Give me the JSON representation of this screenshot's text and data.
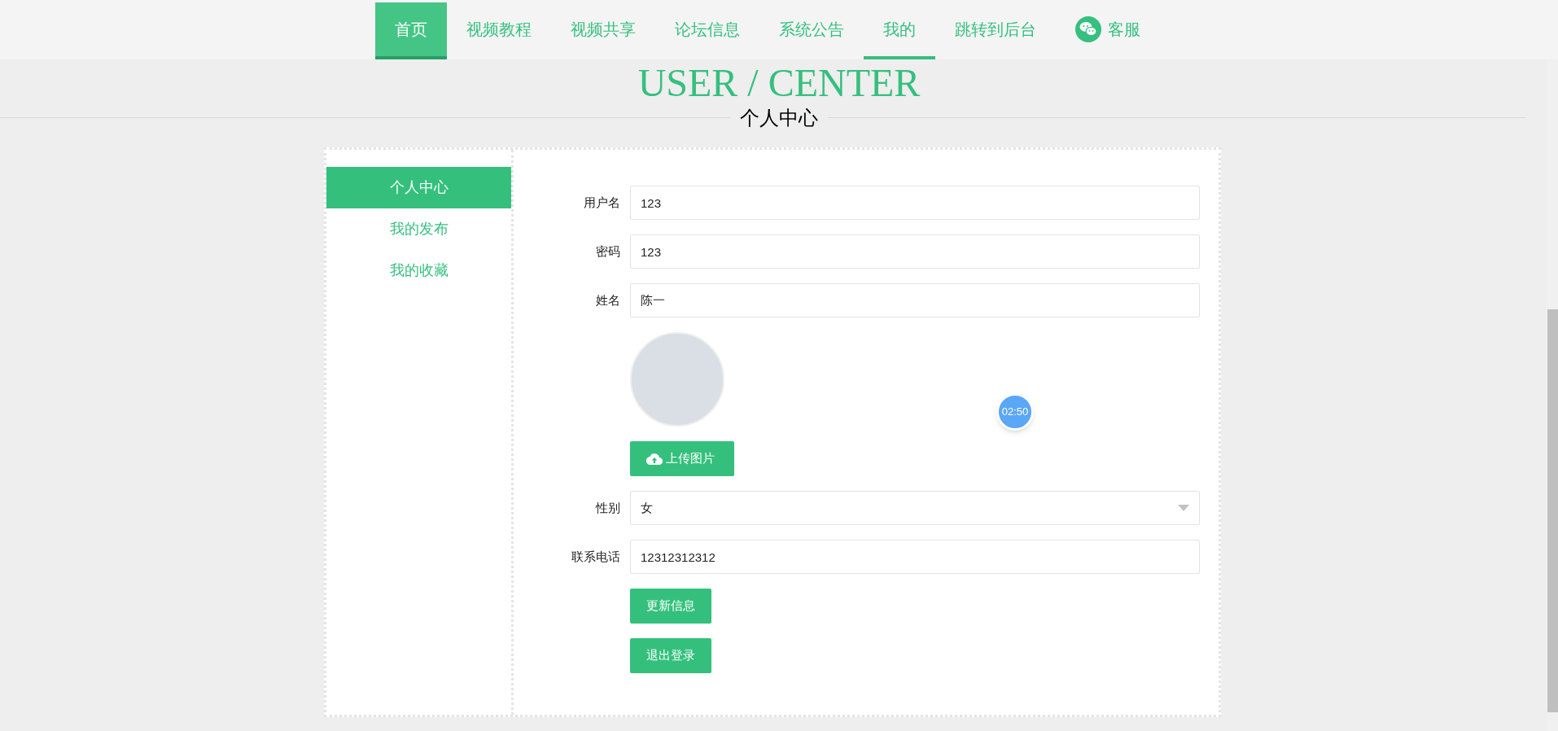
{
  "nav": {
    "items": [
      {
        "label": "首页",
        "kind": "text",
        "selected": false,
        "hovered": true
      },
      {
        "label": "视频教程",
        "kind": "text",
        "selected": false,
        "hovered": false
      },
      {
        "label": "视频共享",
        "kind": "text",
        "selected": false,
        "hovered": false
      },
      {
        "label": "论坛信息",
        "kind": "text",
        "selected": false,
        "hovered": false
      },
      {
        "label": "系统公告",
        "kind": "text",
        "selected": false,
        "hovered": false
      },
      {
        "label": "我的",
        "kind": "text",
        "selected": true,
        "hovered": false
      },
      {
        "label": "跳转到后台",
        "kind": "text",
        "selected": false,
        "hovered": false
      },
      {
        "label": "客服",
        "kind": "wechat",
        "selected": false,
        "hovered": false
      }
    ]
  },
  "header": {
    "title": "USER / CENTER",
    "subtitle": "个人中心"
  },
  "sidebar": {
    "items": [
      {
        "label": "个人中心",
        "selected": true
      },
      {
        "label": "我的发布",
        "selected": false
      },
      {
        "label": "我的收藏",
        "selected": false
      }
    ]
  },
  "form": {
    "rows": [
      {
        "kind": "text",
        "label": "用户名",
        "value": "123"
      },
      {
        "kind": "text",
        "label": "密码",
        "value": "123"
      },
      {
        "kind": "text",
        "label": "姓名",
        "value": "陈一"
      },
      {
        "kind": "avatar"
      },
      {
        "kind": "upload",
        "button": "上传图片"
      },
      {
        "kind": "select",
        "label": "性别",
        "value": "女"
      },
      {
        "kind": "text",
        "label": "联系电话",
        "value": "12312312312"
      },
      {
        "kind": "button",
        "button": "更新信息"
      },
      {
        "kind": "button",
        "button": "退出登录"
      }
    ]
  },
  "timer": {
    "text": "02:50"
  }
}
